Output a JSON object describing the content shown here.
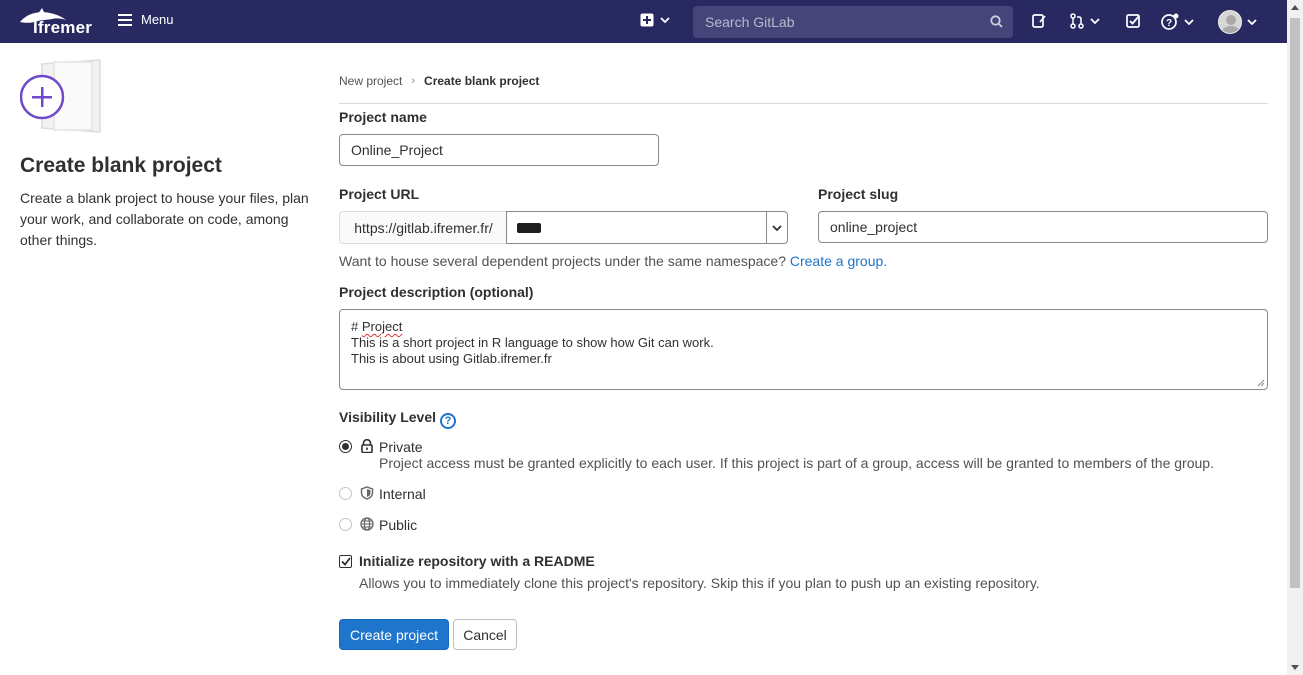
{
  "navbar": {
    "brand": "Ifremer",
    "menu_label": "Menu",
    "search_placeholder": "Search GitLab"
  },
  "left": {
    "title": "Create blank project",
    "description": "Create a blank project to house your files, plan your work, and collaborate on code, among other things."
  },
  "breadcrumb": {
    "items": [
      "New project",
      "Create blank project"
    ]
  },
  "form": {
    "project_name_label": "Project name",
    "project_name_value": "Online_Project",
    "project_url_label": "Project URL",
    "url_prefix": "https://gitlab.ifremer.fr/",
    "project_slug_label": "Project slug",
    "project_slug_value": "online_project",
    "namespace_help": "Want to house several dependent projects under the same namespace?",
    "create_group_link": "Create a group.",
    "description_label": "Project description (optional)",
    "description_lines": [
      "# Project",
      "This is a short project in R language to show how Git can work.",
      "This is about using Gitlab.ifremer.fr"
    ],
    "visibility_label": "Visibility Level",
    "visibility_options": [
      {
        "label": "Private",
        "icon": "lock-icon",
        "checked": true,
        "description": "Project access must be granted explicitly to each user. If this project is part of a group, access will be granted to members of the group."
      },
      {
        "label": "Internal",
        "icon": "shield-icon",
        "checked": false
      },
      {
        "label": "Public",
        "icon": "globe-icon",
        "checked": false
      }
    ],
    "readme_label": "Initialize repository with a README",
    "readme_checked": true,
    "readme_help": "Allows you to immediately clone this project's repository. Skip this if you plan to push up an existing repository.",
    "create_button": "Create project",
    "cancel_button": "Cancel"
  },
  "colors": {
    "navbar": "#292961",
    "primary": "#1f75cb",
    "illustration": "#6e49cb"
  }
}
